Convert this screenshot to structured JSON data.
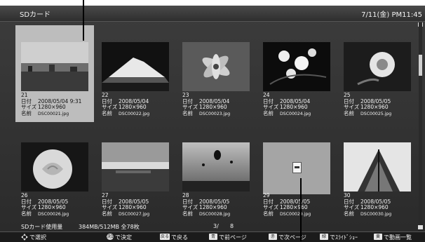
{
  "header": {
    "title": "SDカード",
    "datetime": "7/11(金) PM11:45"
  },
  "thumbnails": [
    {
      "num": "21",
      "date": "2008/05/04 9:31",
      "size": "1280×960",
      "name": "DSC00021.jpg",
      "label_date": "日付",
      "label_size": "サイズ",
      "label_name": "名前",
      "scene": "city"
    },
    {
      "num": "22",
      "date": "2008/05/04",
      "size": "1280×960",
      "name": "DSC00022.jpg",
      "label_date": "日付",
      "label_size": "サイズ",
      "label_name": "名前",
      "scene": "mountain"
    },
    {
      "num": "23",
      "date": "2008/05/04",
      "size": "1280×960",
      "name": "DSC00023.jpg",
      "label_date": "日付",
      "label_size": "サイズ",
      "label_name": "名前",
      "scene": "lily"
    },
    {
      "num": "24",
      "date": "2008/05/04",
      "size": "1280×960",
      "name": "DSC00024.jpg",
      "label_date": "日付",
      "label_size": "サイズ",
      "label_name": "名前",
      "scene": "blossom"
    },
    {
      "num": "25",
      "date": "2008/05/05",
      "size": "1280×960",
      "name": "DSC00025.jpg",
      "label_date": "日付",
      "label_size": "サイズ",
      "label_name": "名前",
      "scene": "flower"
    },
    {
      "num": "26",
      "date": "2008/05/05",
      "size": "1280×960",
      "name": "DSC00026.jpg",
      "label_date": "日付",
      "label_size": "サイズ",
      "label_name": "名前",
      "scene": "rose"
    },
    {
      "num": "27",
      "date": "2008/05/05",
      "size": "1280×960",
      "name": "DSC00027.jpg",
      "label_date": "日付",
      "label_size": "サイズ",
      "label_name": "名前",
      "scene": "sunset"
    },
    {
      "num": "28",
      "date": "2008/05/05",
      "size": "1280×960",
      "name": "DSC00028.jpg",
      "label_date": "日付",
      "label_size": "サイズ",
      "label_name": "名前",
      "scene": "balloons"
    },
    {
      "num": "29",
      "date": "2008/05/05",
      "size": "1280×960",
      "name": "DSC00029.jpg",
      "label_date": "日付",
      "label_size": "サイズ",
      "label_name": "名前",
      "scene": "file"
    },
    {
      "num": "30",
      "date": "2008/05/05",
      "size": "1280×960",
      "name": "DSC00030.jpg",
      "label_date": "日付",
      "label_size": "サイズ",
      "label_name": "名前",
      "scene": "building"
    }
  ],
  "status": {
    "usage_label": "SDカード使用量",
    "usage_value": "384MB/512MB 全78枚",
    "page": "3/",
    "page_total": "8"
  },
  "hints": [
    {
      "key": "",
      "label": "で選択"
    },
    {
      "key": "決定",
      "label": "で決定"
    },
    {
      "key": "戻る",
      "label": "で戻る"
    },
    {
      "key": "青",
      "label": "で前ページ"
    },
    {
      "key": "赤",
      "label": "で次ページ"
    },
    {
      "key": "緑",
      "label": "でｽﾗｲﾄﾞｼｮｰ"
    },
    {
      "key": "黄",
      "label": "で動画一覧"
    }
  ]
}
